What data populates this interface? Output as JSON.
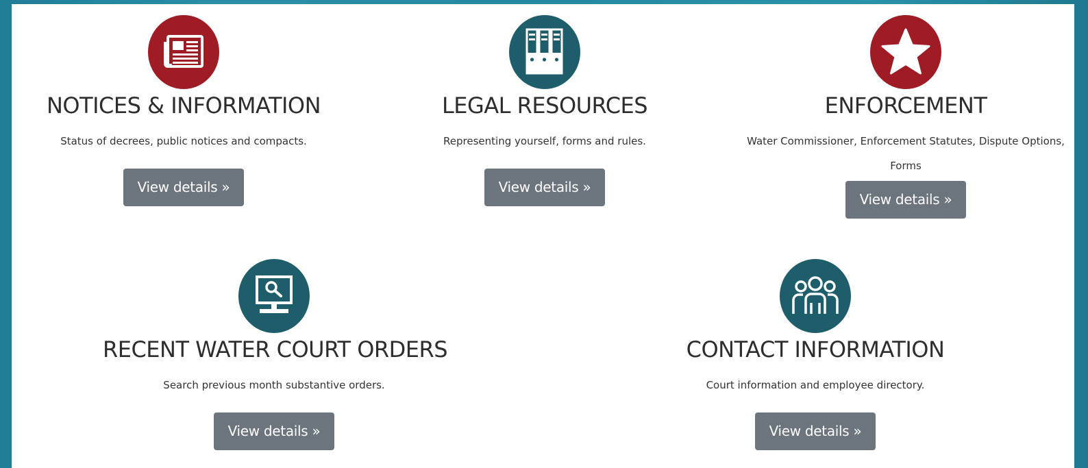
{
  "colors": {
    "red": "#a01c24",
    "teal": "#1e5e6b",
    "button": "#6c757d",
    "background": "#2589a0"
  },
  "cards": [
    {
      "icon": "newspaper-icon",
      "title": "NOTICES & INFORMATION",
      "description": "Status of decrees, public notices and compacts.",
      "button": "View details »"
    },
    {
      "icon": "binders-icon",
      "title": "LEGAL RESOURCES",
      "description": "Representing yourself, forms and rules.",
      "button": "View details »"
    },
    {
      "icon": "star-icon",
      "title": "ENFORCEMENT",
      "description": "Water Commissioner, Enforcement Statutes, Dispute Options, Forms",
      "button": "View details »"
    },
    {
      "icon": "monitor-search-icon",
      "title": "RECENT WATER COURT ORDERS",
      "description": "Search previous month substantive orders.",
      "button": "View details »"
    },
    {
      "icon": "people-icon",
      "title": "CONTACT INFORMATION",
      "description": "Court information and employee directory.",
      "button": "View details »"
    }
  ]
}
